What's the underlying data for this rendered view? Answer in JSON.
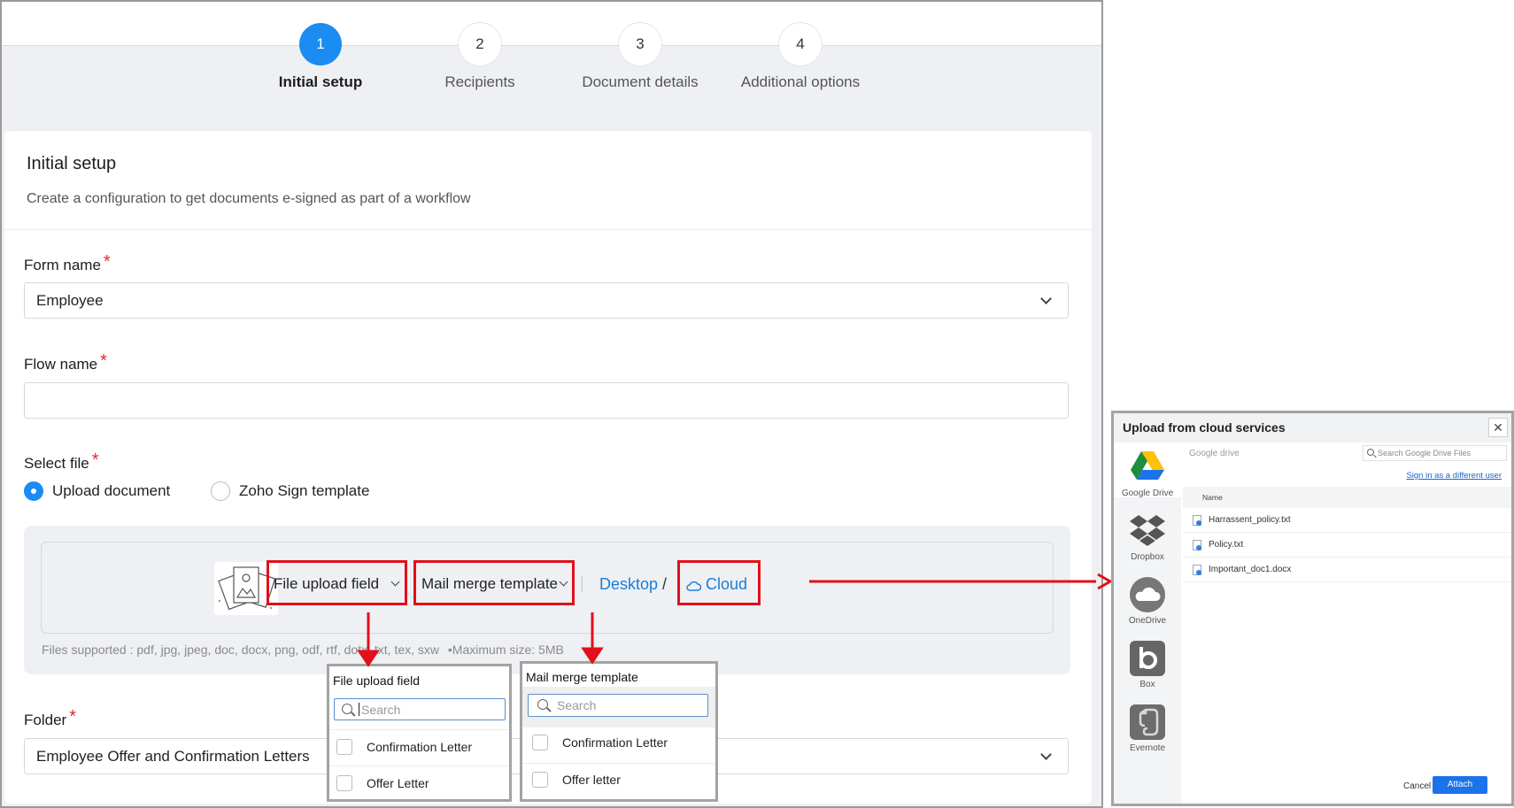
{
  "stepper": {
    "steps": [
      {
        "number": "1",
        "label": "Initial setup",
        "active": true
      },
      {
        "number": "2",
        "label": "Recipients",
        "active": false
      },
      {
        "number": "3",
        "label": "Document details",
        "active": false
      },
      {
        "number": "4",
        "label": "Additional options",
        "active": false
      }
    ]
  },
  "card": {
    "title": "Initial setup",
    "subtitle": "Create a configuration to get documents e-signed as part of a workflow"
  },
  "form": {
    "form_name_label": "Form name",
    "form_name_value": "Employee",
    "flow_name_label": "Flow name",
    "flow_name_value": "",
    "required_mark": "*",
    "select_file_label": "Select file",
    "radio_upload": "Upload document",
    "radio_template": "Zoho Sign template",
    "folder_label": "Folder",
    "folder_value": "Employee Offer and Confirmation Letters"
  },
  "upload": {
    "file_upload_field": "File upload field",
    "mail_merge_template": "Mail merge template",
    "desktop": "Desktop",
    "slash": "/",
    "cloud": "Cloud",
    "pipe": "|",
    "files_supported": "Files supported : pdf, jpg, jpeg, doc, docx, png, odf, rtf, dotx, txt, tex, sxw",
    "max_size": "•Maximum size: 5MB"
  },
  "popover_file_upload": {
    "title": "File upload field",
    "search_placeholder": "Search",
    "items": [
      "Confirmation Letter",
      "Offer Letter"
    ]
  },
  "popover_mail_merge": {
    "title": "Mail merge template",
    "search_placeholder": "Search",
    "items": [
      "Confirmation Letter",
      "Offer letter"
    ]
  },
  "cloud_dialog": {
    "title": "Upload from cloud services",
    "close": "✕",
    "services": [
      "Google Drive",
      "Dropbox",
      "OneDrive",
      "Box",
      "Evernote"
    ],
    "source_label": "Google drive",
    "search_placeholder": "Search Google Drive Files",
    "sign_in_link": "Sign in as a different user",
    "column_name": "Name",
    "files": [
      "Harrassent_policy.txt",
      "Policy.txt",
      "Important_doc1.docx"
    ],
    "cancel": "Cancel",
    "attach": "Attach"
  },
  "colors": {
    "accent": "#1a8cf2",
    "highlight_red": "#e1101a",
    "link_blue": "#1a7fd6",
    "attach_blue": "#1a73e8"
  }
}
